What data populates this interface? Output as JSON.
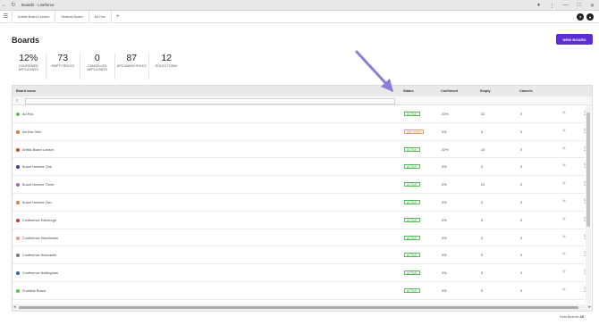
{
  "window": {
    "title": "Boards - Liveforce"
  },
  "tabs": [
    {
      "label": "Artists Board London"
    },
    {
      "label": "Musical Board"
    },
    {
      "label": "Ad Hoc"
    }
  ],
  "page": {
    "title": "Boards",
    "new_board_label": "NEW BOARD"
  },
  "stats": [
    {
      "value": "12%",
      "label": "CONFIRMED APPLICANTS"
    },
    {
      "value": "73",
      "label": "EMPTY ROLES"
    },
    {
      "value": "0",
      "label": "CANCELLED APPLICANTS"
    },
    {
      "value": "87",
      "label": "UPCOMING ROLES"
    },
    {
      "value": "12",
      "label": "ROLES TODAY"
    }
  ],
  "table": {
    "columns": {
      "name": "Board name",
      "status": "Status",
      "confirmed": "Confirmed",
      "empty": "Empty",
      "cancels": "Cancels"
    },
    "rows": [
      {
        "name": "Ad Hoc",
        "color": "#4cc94c",
        "status": "ACTIVE",
        "status_type": "active",
        "confirmed": "23%",
        "empty": "22",
        "cancels": "0"
      },
      {
        "name": "Ad Hoc Jello",
        "color": "#e07a3a",
        "status": "ARCHIVED",
        "status_type": "archived",
        "confirmed": "0%",
        "empty": "0",
        "cancels": "0"
      },
      {
        "name": "Artists Board London",
        "color": "#d4452e",
        "status": "ACTIVE",
        "status_type": "active",
        "confirmed": "22%",
        "empty": "14",
        "cancels": "0"
      },
      {
        "name": "Board Number One",
        "color": "#3a3fb0",
        "status": "ACTIVE",
        "status_type": "active",
        "confirmed": "0%",
        "empty": "0",
        "cancels": "0"
      },
      {
        "name": "Board Number Three",
        "color": "#b45ec9",
        "status": "ACTIVE",
        "status_type": "active",
        "confirmed": "0%",
        "empty": "24",
        "cancels": "0"
      },
      {
        "name": "Board Number Two",
        "color": "#e07a3a",
        "status": "ACTIVE",
        "status_type": "active",
        "confirmed": "0%",
        "empty": "0",
        "cancels": "0"
      },
      {
        "name": "Conference Edinburgh",
        "color": "#c93a2e",
        "status": "ACTIVE",
        "status_type": "active",
        "confirmed": "0%",
        "empty": "0",
        "cancels": "0"
      },
      {
        "name": "Conference Manchester",
        "color": "#e59a7e",
        "status": "ACTIVE",
        "status_type": "active",
        "confirmed": "0%",
        "empty": "0",
        "cancels": "0"
      },
      {
        "name": "Conference Newcastle",
        "color": "#777777",
        "status": "ACTIVE",
        "status_type": "active",
        "confirmed": "0%",
        "empty": "0",
        "cancels": "0"
      },
      {
        "name": "Conference Nottingham",
        "color": "#2f6aa8",
        "status": "ACTIVE",
        "status_type": "active",
        "confirmed": "0%",
        "empty": "0",
        "cancels": "0"
      },
      {
        "name": "Frontline Board",
        "color": "#4cc94c",
        "status": "ACTIVE",
        "status_type": "active",
        "confirmed": "0%",
        "empty": "0",
        "cancels": "0"
      }
    ]
  },
  "footer": {
    "label": "Total Boards:",
    "count": "10"
  },
  "colors": {
    "accent": "#5b2fd1",
    "active": "#3a9b3a",
    "archived": "#e0883a",
    "pointer_arrow": "#8f7ad8"
  }
}
